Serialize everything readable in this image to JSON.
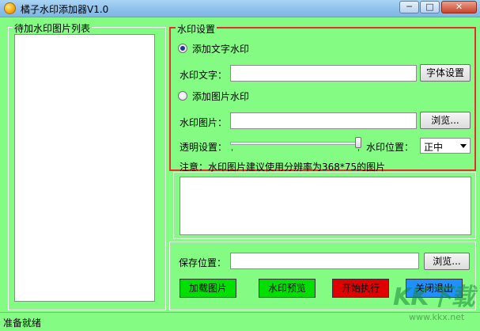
{
  "window": {
    "title": "橘子水印添加器V1.0",
    "min_glyph": "─",
    "max_glyph": "□",
    "close_glyph": "✕"
  },
  "list_group": {
    "legend": "待加水印图片列表"
  },
  "settings": {
    "legend": "水印设置",
    "text_mode_label": "添加文字水印",
    "text_mode_checked": true,
    "text_label": "水印文字：",
    "text_value": "",
    "font_button": "字体设置",
    "image_mode_label": "添加图片水印",
    "image_mode_checked": false,
    "image_label": "水印图片：",
    "image_value": "",
    "browse_button": "浏览...",
    "opacity_label": "透明设置：",
    "opacity_value": 1.0,
    "position_label": "水印位置：",
    "position_value": "正中",
    "note": "注意：水印图片建议使用分辨率为368*75的图片"
  },
  "output": {
    "save_label": "保存位置：",
    "save_value": "",
    "browse_button": "浏览..."
  },
  "actions": {
    "load": {
      "label": "加载图片",
      "color": "#00e000"
    },
    "preview": {
      "label": "水印预览",
      "color": "#00e000"
    },
    "start": {
      "label": "开始执行",
      "color": "#e00000"
    },
    "exit": {
      "label": "关闭退出",
      "color": "#1e90ff"
    }
  },
  "status": {
    "text": "准备就绪"
  },
  "watermark": {
    "big": "KK下载",
    "small": "www.kkx.net"
  },
  "colors": {
    "client_bg": "#84fc84",
    "highlight_border": "#e53030"
  }
}
